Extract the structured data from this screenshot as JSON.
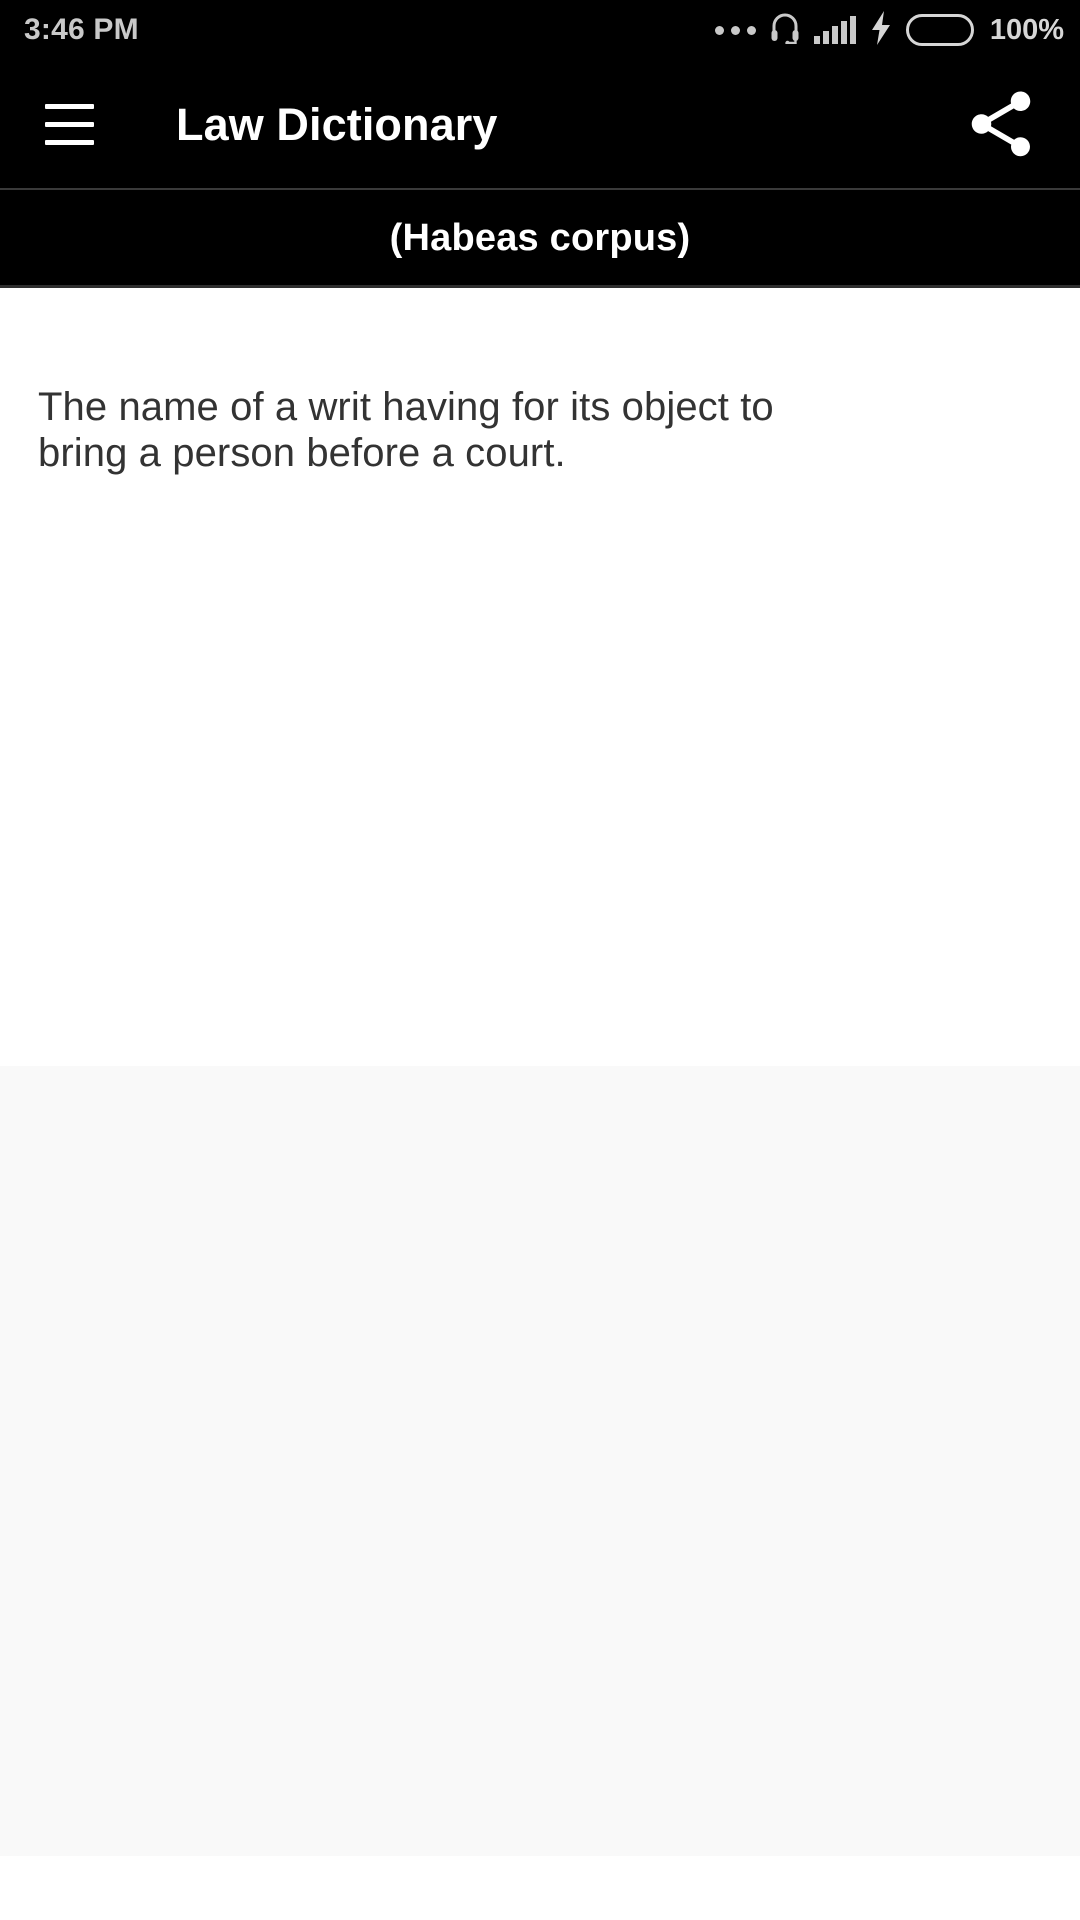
{
  "status_bar": {
    "time": "3:46 PM",
    "battery_percent": "100%",
    "icons": [
      "more-dots-icon",
      "headset-icon",
      "signal-bars-icon",
      "charging-bolt-icon",
      "battery-icon"
    ],
    "colors": {
      "background": "#000000",
      "text": "#c9c9c9",
      "battery_fill": "#3fc60c"
    }
  },
  "app_bar": {
    "menu_icon": "hamburger-menu-icon",
    "title": "Law Dictionary",
    "share_icon": "share-icon",
    "colors": {
      "background": "#000000",
      "title": "#ffffff"
    }
  },
  "subtitle_bar": {
    "term": "(Habeas corpus)",
    "colors": {
      "background": "#000000",
      "text": "#ffffff",
      "divider": "#3a3a3a"
    }
  },
  "content": {
    "definition": "The name of a writ having for its object to bring a person before a court.",
    "colors": {
      "card_background": "#ffffff",
      "text": "#333333",
      "page_background": "#f9f9f9"
    }
  }
}
